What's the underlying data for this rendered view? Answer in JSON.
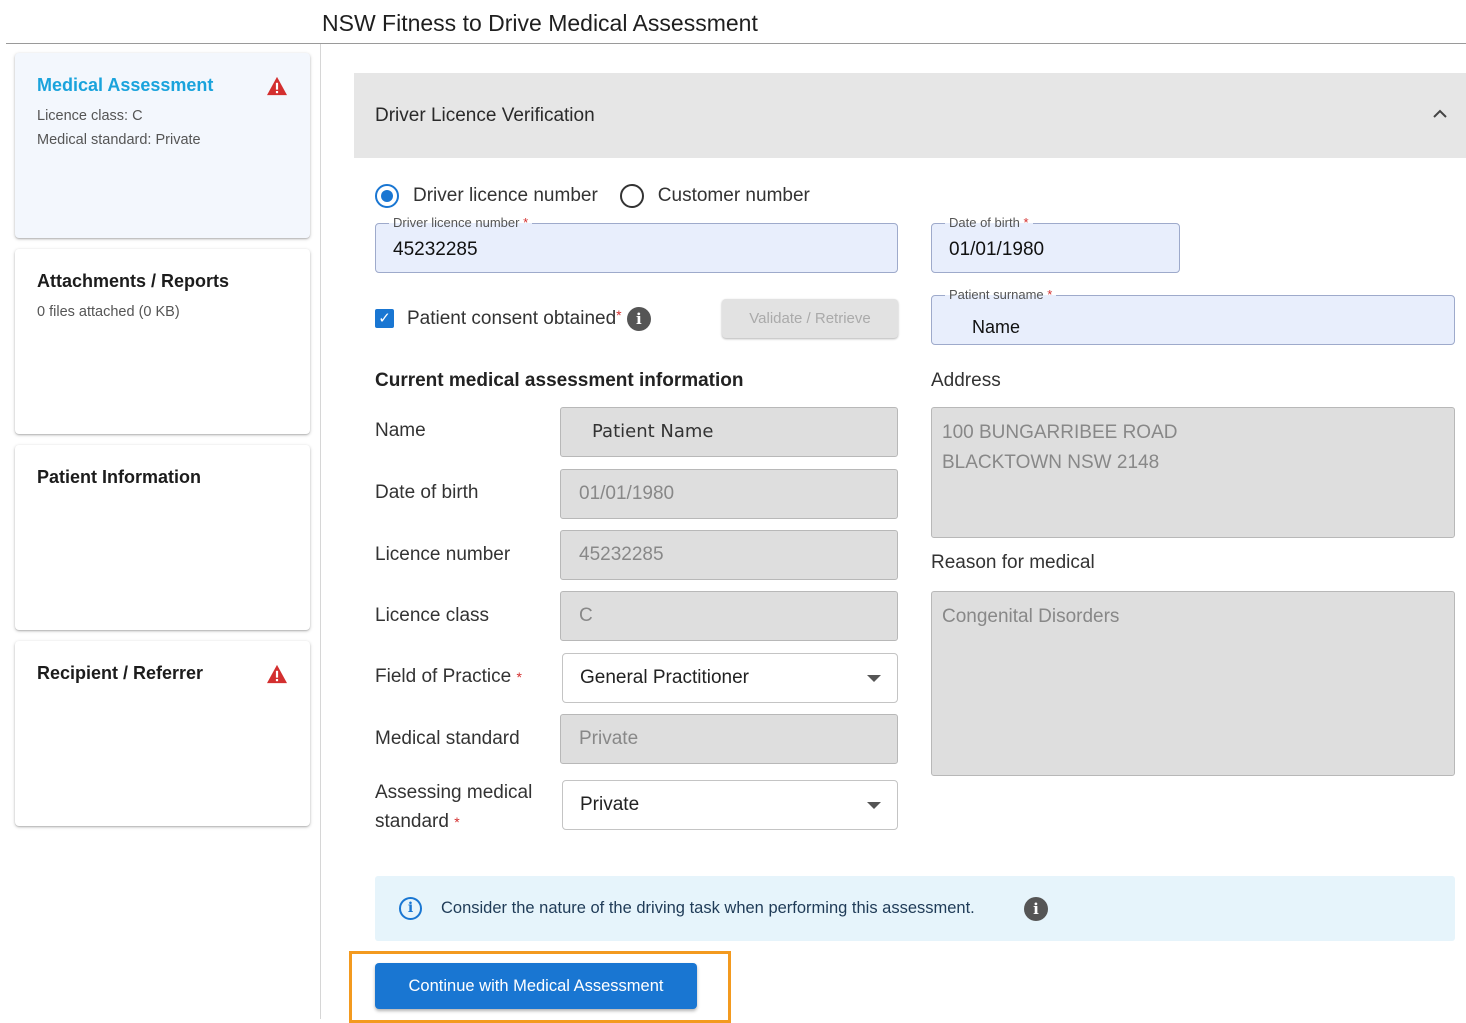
{
  "app": {
    "title": "NSW Fitness to Drive Medical Assessment"
  },
  "sidebar": {
    "cards": [
      {
        "title": "Medical Assessment",
        "lines": [
          "Licence class: C",
          "Medical standard: Private"
        ],
        "warning": true
      },
      {
        "title": "Attachments / Reports",
        "lines": [
          "0 files attached (0 KB)"
        ],
        "warning": false
      },
      {
        "title": "Patient Information",
        "lines": [],
        "warning": false
      },
      {
        "title": "Recipient / Referrer",
        "lines": [],
        "warning": true
      }
    ]
  },
  "panel": {
    "title": "Driver Licence Verification",
    "radio": {
      "option1": "Driver licence number",
      "option2": "Customer number",
      "selected": "Driver licence number"
    },
    "licence_field": {
      "label": "Driver licence number",
      "required": "*",
      "value": "45232285"
    },
    "dob_field": {
      "label": "Date of birth",
      "required": "*",
      "value": "01/01/1980"
    },
    "surname_field": {
      "label": "Patient surname",
      "required": "*",
      "value": "Name"
    },
    "consent": {
      "label": "Patient consent obtained",
      "required": "*",
      "checked": true
    },
    "validate_button": "Validate / Retrieve",
    "section_title": "Current medical assessment information",
    "rows": {
      "name": {
        "label": "Name",
        "value": "Patient Name"
      },
      "dob": {
        "label": "Date of birth",
        "value": "01/01/1980"
      },
      "licence_number": {
        "label": "Licence number",
        "value": "45232285"
      },
      "licence_class": {
        "label": "Licence class",
        "value": "C"
      },
      "field_of_practice": {
        "label": "Field of Practice",
        "required": "*",
        "value": "General Practitioner"
      },
      "medical_standard": {
        "label": "Medical standard",
        "value": "Private"
      },
      "assessing_standard": {
        "label_line1": "Assessing medical",
        "label_line2": "standard",
        "required": "*",
        "value": "Private"
      }
    },
    "address": {
      "label": "Address",
      "line1": "100 BUNGARRIBEE ROAD",
      "line2": "BLACKTOWN NSW 2148"
    },
    "reason": {
      "label": "Reason for medical",
      "value": "Congenital Disorders"
    },
    "info_banner": "Consider the nature of the driving task when performing this assessment.",
    "continue_button": "Continue with Medical Assessment"
  },
  "colors": {
    "accent": "#1976d2",
    "active_title": "#1aa3dc",
    "warning": "#d32f2f",
    "highlight": "#f39a1f"
  }
}
